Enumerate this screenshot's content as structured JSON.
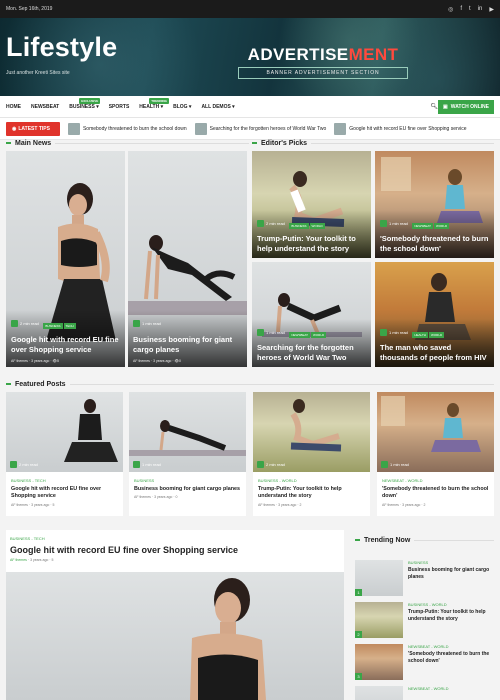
{
  "topbar": {
    "date": "Mon. Sep 16th, 2019",
    "social": [
      "instagram-icon",
      "facebook-icon",
      "twitter-icon",
      "linkedin-icon",
      "youtube-icon"
    ]
  },
  "header": {
    "logo": "Lifestyle",
    "tagline": "Just another Kreeti Sites site",
    "ad_title_part1": "ADVERTISE",
    "ad_title_part2": "MENT",
    "ad_subtitle": "BANNER ADVERTISEMENT SECTION"
  },
  "nav": {
    "items": [
      {
        "label": "HOME"
      },
      {
        "label": "NEWSBEAT"
      },
      {
        "label": "BUSINESS ▾",
        "badge": "EXCLUSIVE"
      },
      {
        "label": "SPORTS"
      },
      {
        "label": "HEALTH ▾",
        "badge": "TRENDING"
      },
      {
        "label": "BLOG ▾"
      },
      {
        "label": "ALL DEMOS ▾"
      }
    ],
    "watch_label": "WATCH ONLINE"
  },
  "ticker": {
    "label": "LATEST TIPS",
    "items": [
      "Somebody threatened to burn the school down",
      "Searching for the forgotten heroes of World War Two",
      "Google hit with record EU fine over Shopping service"
    ]
  },
  "sections": {
    "main_news": "Main News",
    "editors_picks": "Editor's Picks",
    "featured_posts": "Featured Posts",
    "trending_now": "Trending Now"
  },
  "main_news": [
    {
      "title": "Google hit with record EU fine over Shopping service",
      "cats": [
        "BUSINESS",
        "TECH"
      ],
      "read": "2 min read",
      "author": "AF themes",
      "time": "3 years ago",
      "views": "5"
    },
    {
      "title": "Business booming for giant cargo planes",
      "cats": [],
      "read": "1 min read",
      "author": "AF themes",
      "time": "3 years ago",
      "views": "0"
    }
  ],
  "editors_picks": [
    {
      "title": "Trump-Putin: Your toolkit to help understand the story",
      "cats": [
        "BUSINESS",
        "WORLD"
      ],
      "read": "2 min read"
    },
    {
      "title": "'Somebody threatened to burn the school down'",
      "cats": [
        "NEWSBEAT",
        "WORLD"
      ],
      "read": "1 min read"
    },
    {
      "title": "Searching for the forgotten heroes of World War Two",
      "cats": [
        "NEWSBEAT",
        "WORLD"
      ],
      "read": "1 min read"
    },
    {
      "title": "The man who saved thousands of people from HIV",
      "cats": [
        "HEALTH",
        "WORLD"
      ],
      "read": "1 min read"
    }
  ],
  "featured": [
    {
      "cat": "BUSINESS - TECH",
      "title": "Google hit with record EU fine over Shopping service",
      "read": "2 min read",
      "author": "AF themes",
      "time": "3 years ago",
      "views": "5"
    },
    {
      "cat": "BUSINESS",
      "title": "Business booming for giant cargo planes",
      "read": "1 min read",
      "author": "AF themes",
      "time": "3 years ago",
      "views": "0"
    },
    {
      "cat": "BUSINESS - WORLD",
      "title": "Trump-Putin: Your toolkit to help understand the story",
      "read": "2 min read",
      "author": "AF themes",
      "time": "3 years ago",
      "views": "2"
    },
    {
      "cat": "NEWSBEAT - WORLD",
      "title": "'Somebody threatened to burn the school down'",
      "read": "1 min read",
      "author": "AF themes",
      "time": "3 years ago",
      "views": "2"
    }
  ],
  "big_post": {
    "cat": "BUSINESS - TECH",
    "title": "Google hit with record EU fine over Shopping service",
    "author": "AF themes",
    "time": "3 years ago",
    "views": "5"
  },
  "trending": [
    {
      "num": "1",
      "cat": "BUSINESS",
      "title": "Business booming for giant cargo planes"
    },
    {
      "num": "2",
      "cat": "BUSINESS - WORLD",
      "title": "Trump-Putin: Your toolkit to help understand the story"
    },
    {
      "num": "3",
      "cat": "NEWSBEAT - WORLD",
      "title": "'Somebody threatened to burn the school down'"
    },
    {
      "num": "4",
      "cat": "NEWSBEAT - WORLD",
      "title": ""
    }
  ]
}
